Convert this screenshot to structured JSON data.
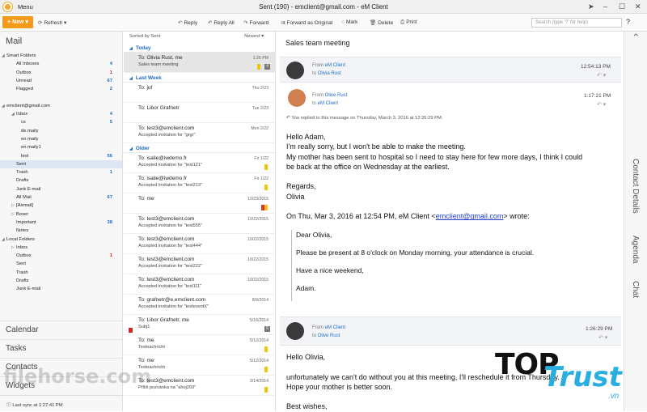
{
  "titlebar": {
    "menu": "Menu",
    "title": "Sent (190) - emclient@gmail.com - eM Client"
  },
  "toolbar": {
    "new": "New",
    "refresh": "Refresh",
    "reply": "Reply",
    "reply_all": "Reply All",
    "forward": "Forward",
    "forward_original": "Forward as Original",
    "mark": "Mark",
    "delete": "Delete",
    "print": "Print",
    "search_placeholder": "Search (type '?' for help)"
  },
  "sidebar": {
    "title": "Mail",
    "items": [
      {
        "label": "Smart Folders",
        "indent": 8,
        "tri": "◢",
        "count": ""
      },
      {
        "label": "All Inboxes",
        "indent": 20,
        "count": "4"
      },
      {
        "label": "Outbox",
        "indent": 20,
        "count": "1",
        "red": true
      },
      {
        "label": "Unread",
        "indent": 20,
        "count": "67"
      },
      {
        "label": "Flagged",
        "indent": 20,
        "count": "2"
      },
      {
        "label": "",
        "indent": 20,
        "count": ""
      },
      {
        "label": "emclient@gmail.com",
        "indent": 8,
        "tri": "◢",
        "count": ""
      },
      {
        "label": "Inbox",
        "indent": 20,
        "tri": "◢",
        "count": "4"
      },
      {
        "label": "cs",
        "indent": 26,
        "count": "5"
      },
      {
        "label": "de maily",
        "indent": 26,
        "count": ""
      },
      {
        "label": "en maily",
        "indent": 26,
        "count": ""
      },
      {
        "label": "en maily1",
        "indent": 26,
        "count": ""
      },
      {
        "label": "test",
        "indent": 26,
        "count": "56"
      },
      {
        "label": "Sent",
        "indent": 20,
        "count": "",
        "sel": true
      },
      {
        "label": "Trash",
        "indent": 20,
        "count": "1"
      },
      {
        "label": "Drafts",
        "indent": 20,
        "count": ""
      },
      {
        "label": "Junk E-mail",
        "indent": 20,
        "count": ""
      },
      {
        "label": "All Mail",
        "indent": 20,
        "count": "67"
      },
      {
        "label": "[Airmail]",
        "indent": 20,
        "tri": "▷",
        "count": ""
      },
      {
        "label": "Boxer",
        "indent": 20,
        "tri": "▷",
        "count": ""
      },
      {
        "label": "Important",
        "indent": 20,
        "count": "38"
      },
      {
        "label": "Notes",
        "indent": 20,
        "count": ""
      },
      {
        "label": "Local Folders",
        "indent": 8,
        "tri": "◢",
        "count": ""
      },
      {
        "label": "Inbox",
        "indent": 20,
        "tri": "▷",
        "count": ""
      },
      {
        "label": "Outbox",
        "indent": 20,
        "count": "1",
        "red": true
      },
      {
        "label": "Sent",
        "indent": 20,
        "count": ""
      },
      {
        "label": "Trash",
        "indent": 20,
        "count": ""
      },
      {
        "label": "Drafts",
        "indent": 20,
        "count": ""
      },
      {
        "label": "Junk E-mail",
        "indent": 20,
        "count": ""
      }
    ],
    "modules": [
      "Calendar",
      "Tasks",
      "Contacts",
      "Widgets"
    ],
    "last_sync": "Last sync at 1:27:41 PM"
  },
  "list": {
    "sorted_by": "Sorted by Sent",
    "sort_order": "Newest",
    "groups": [
      {
        "name": "Today",
        "items": [
          {
            "to": "To: Olivia Rust, me",
            "sub": "Sales team meeting",
            "date": "1:26 PM",
            "sel": true,
            "flag": true,
            "badge": "4"
          }
        ]
      },
      {
        "name": "Last Week",
        "items": [
          {
            "to": "To: juf",
            "sub": "",
            "date": "Thu 2/23"
          },
          {
            "to": "To: Libor Grafnetr",
            "sub": "",
            "date": "Tue 2/23"
          },
          {
            "to": "To: test3@emclient.com",
            "sub": "Accepted invitation for \"grgr\"",
            "date": "Mon 2/22"
          }
        ]
      },
      {
        "name": "Older",
        "items": [
          {
            "to": "To: isalie@iwdemo.fr",
            "sub": "Accepted invitation for \"test121\"",
            "date": "Fri 1/22",
            "flag": true
          },
          {
            "to": "To: isalie@iwdemo.fr",
            "sub": "Accepted invitation for \"test213\"",
            "date": "Fri 1/22",
            "flag": true
          },
          {
            "to": "To: me",
            "sub": "",
            "date": "10/23/2015",
            "flag": true,
            "flag2": true
          },
          {
            "to": "To: test3@emclient.com",
            "sub": "Accepted invitation for \"test555\"",
            "date": "10/22/2015"
          },
          {
            "to": "To: test3@emclient.com",
            "sub": "Accepted invitation for \"test444\"",
            "date": "10/22/2015"
          },
          {
            "to": "To: test3@emclient.com",
            "sub": "Accepted invitation for \"test222\"",
            "date": "10/22/2015"
          },
          {
            "to": "To: test3@emclient.com",
            "sub": "Accepted invitation for \"test111\"",
            "date": "10/22/2015"
          },
          {
            "to": "To: grafnetr@e.emclient.com",
            "sub": "Accepted invitation for \"testeventX\"",
            "date": "8/9/2014"
          },
          {
            "to": "To: Libor Grafnetr, me",
            "sub": "Subj1",
            "date": "5/16/2014",
            "badge": "6",
            "redflag": true
          },
          {
            "to": "To: me",
            "sub": "Testnachricht",
            "date": "5/12/2014",
            "flag": true
          },
          {
            "to": "To: me",
            "sub": "Testnachricht",
            "date": "5/12/2014",
            "flag": true
          },
          {
            "to": "To: test3@emclient.com",
            "sub": "Příliš pozvánka na \"ahoj203\"",
            "date": "3/14/2014",
            "flag": true
          }
        ]
      }
    ]
  },
  "reading": {
    "subject": "Sales team meeting",
    "msg1": {
      "from_label": "From",
      "from": "eM Client",
      "to_label": "to",
      "to": "Olivia Rust",
      "time": "12:54:13 PM"
    },
    "msg2": {
      "from_label": "From",
      "from": "Olive Rust",
      "to_label": "to",
      "to": "eM Client",
      "time": "1:17:21 PM"
    },
    "replied_note": "You replied to this message on Thursday, March 3, 2016 at 12:26:29 PM.",
    "body_lines": [
      "Hello Adam,",
      "I'm really sorry, but I won't be able to make the meeting.",
      "My mother has been sent to hospital so I need to stay here for few more days, I think I could",
      "be back at the office on Wednesday at the earliest.",
      "",
      "Regards,",
      "Olivia",
      "",
      "On Thu, Mar 3, 2016 at 12:54 PM, eM Client <"
    ],
    "wrote_link": "emclient@gmail.com",
    "wrote_suffix": "> wrote:",
    "quote_lines": [
      "Dear Olivia,",
      "Please be present at 8 o'clock on Monday morning, your attendance is crucial.",
      "Have a nice weekend,",
      "Adam."
    ],
    "msg3": {
      "from_label": "From",
      "from": "eM Client",
      "to_label": "to",
      "to": "Olive Rust",
      "time": "1:26:29 PM"
    },
    "body2_lines": [
      "Hello Olivia,",
      "",
      "unfortunately we can't do without you at this meeting, I'll reschedule it from Thursday.",
      "Hope your mother is better soon.",
      "",
      "Best wishes,"
    ]
  },
  "rightbar": {
    "contact_details": "Contact Details",
    "agenda": "Agenda",
    "chat": "Chat"
  },
  "overlays": {
    "watermark": "filehorse.com",
    "brand_top": "TOP",
    "brand_trust": "Trust",
    "brand_vn": ".vn"
  }
}
